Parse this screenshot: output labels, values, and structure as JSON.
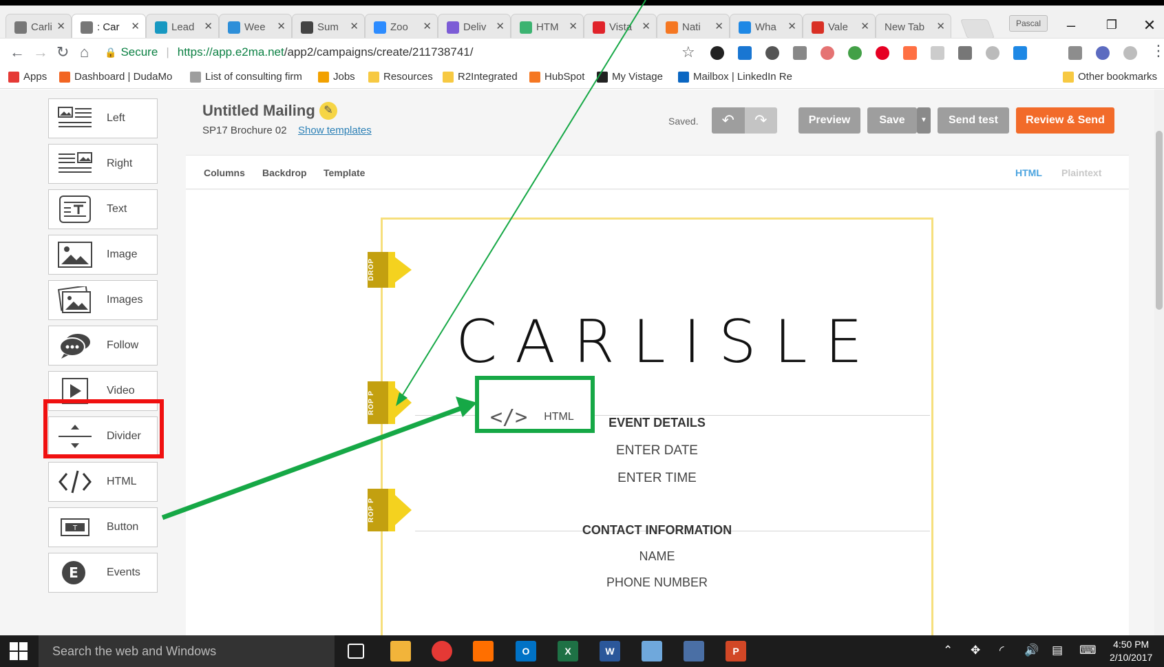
{
  "browser": {
    "tabs": [
      {
        "title": "Carli",
        "icon": "globe-icon",
        "color": "#777777",
        "active": false
      },
      {
        "title": ": Car",
        "icon": "page-icon",
        "color": "#777777",
        "active": true
      },
      {
        "title": "Lead",
        "icon": "cloud-icon",
        "color": "#1798c1",
        "active": false
      },
      {
        "title": "Wee",
        "icon": "weebly-icon",
        "color": "#2e8fd9",
        "active": false
      },
      {
        "title": "Sum",
        "icon": "mailchimp-icon",
        "color": "#444444",
        "active": false
      },
      {
        "title": "Zoo",
        "icon": "zoom-icon",
        "color": "#2d8cff",
        "active": false
      },
      {
        "title": "Deliv",
        "icon": "gear-icon",
        "color": "#7c5cd6",
        "active": false
      },
      {
        "title": "HTM",
        "icon": "html-icon",
        "color": "#3cb371",
        "active": false
      },
      {
        "title": "Vista",
        "icon": "check-icon",
        "color": "#e0232a",
        "active": false
      },
      {
        "title": "Nati",
        "icon": "hubspot-icon",
        "color": "#f57722",
        "active": false
      },
      {
        "title": "Wha",
        "icon": "app-icon",
        "color": "#1e88e5",
        "active": false
      },
      {
        "title": "Vale",
        "icon": "gmail-icon",
        "color": "#d93025",
        "active": false
      },
      {
        "title": "New Tab",
        "icon": "",
        "color": "",
        "active": false
      }
    ],
    "tab_close": "✕",
    "profile": "Pascal",
    "secure_label": "Secure",
    "url_host": "https://app.e2ma.net",
    "url_path": "/app2/campaigns/create/211738741/",
    "bookmarks": [
      {
        "label": "Apps",
        "icon": "apps-grid-icon",
        "color": "#e53935"
      },
      {
        "label": "Dashboard | DudaMo",
        "icon": "duda-icon",
        "color": "#f26522"
      },
      {
        "label": "List of consulting firm",
        "icon": "cloud-outline-icon",
        "color": "#9e9e9e"
      },
      {
        "label": "Jobs",
        "icon": "search-icon",
        "color": "#f2a100"
      },
      {
        "label": "Resources",
        "icon": "folder-icon",
        "color": "#f7c942"
      },
      {
        "label": "R2Integrated",
        "icon": "folder-icon",
        "color": "#f7c942"
      },
      {
        "label": "HubSpot",
        "icon": "hubspot-icon",
        "color": "#f57722"
      },
      {
        "label": "My Vistage",
        "icon": "info-icon",
        "color": "#222222"
      },
      {
        "label": "Mailbox | LinkedIn Re",
        "icon": "chat-icon",
        "color": "#0a66c2"
      }
    ],
    "other_bookmarks": "Other bookmarks"
  },
  "blocks": [
    {
      "label": "Left",
      "icon": "image-left-icon"
    },
    {
      "label": "Right",
      "icon": "image-right-icon"
    },
    {
      "label": "Text",
      "icon": "text-block-icon"
    },
    {
      "label": "Image",
      "icon": "image-icon"
    },
    {
      "label": "Images",
      "icon": "images-icon"
    },
    {
      "label": "Follow",
      "icon": "follow-chat-icon"
    },
    {
      "label": "Video",
      "icon": "video-play-icon"
    },
    {
      "label": "Divider",
      "icon": "divider-icon"
    },
    {
      "label": "HTML",
      "icon": "code-icon"
    },
    {
      "label": "Button",
      "icon": "button-icon"
    },
    {
      "label": "Events",
      "icon": "events-icon"
    }
  ],
  "editor": {
    "title": "Untitled Mailing",
    "template_name": "SP17 Brochure 02",
    "show_templates": "Show templates",
    "saved": "Saved.",
    "preview": "Preview",
    "save": "Save",
    "send_test": "Send test",
    "review_send": "Review & Send",
    "subnav": {
      "columns": "Columns",
      "backdrop": "Backdrop",
      "template": "Template",
      "html": "HTML",
      "plaintext": "Plaintext"
    }
  },
  "email": {
    "drop_label": "DROP",
    "drop_label_cut": "ROP P",
    "brand": "CARLISLE",
    "dragged_block_label": "HTML",
    "code_glyph": "</>",
    "event_heading": "EVENT DETAILS",
    "enter_date": "ENTER DATE",
    "enter_time": "ENTER TIME",
    "contact_heading": "CONTACT INFORMATION",
    "name": "NAME",
    "phone": "PHONE NUMBER"
  },
  "annotation_colors": {
    "red": "#f01010",
    "green": "#16a846"
  },
  "taskbar": {
    "search_placeholder": "Search the web and Windows",
    "time": "4:50 PM",
    "date": "2/10/2017"
  }
}
